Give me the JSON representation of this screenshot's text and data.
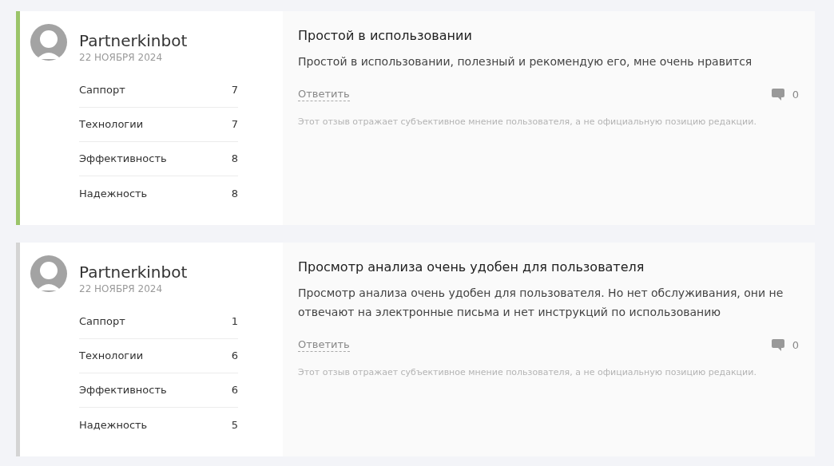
{
  "reviews": [
    {
      "color": "#9bc46a",
      "author": "Partnerkinbot",
      "date": "22 НОЯБРЯ 2024",
      "ratings": [
        {
          "label": "Саппорт",
          "value": "7"
        },
        {
          "label": "Технологии",
          "value": "7"
        },
        {
          "label": "Эффективность",
          "value": "8"
        },
        {
          "label": "Надежность",
          "value": "8"
        }
      ],
      "title": "Простой в использовании",
      "text": "Простой в использовании, полезный и рекомендую его, мне очень нравится",
      "reply": "Ответить",
      "comments": "0",
      "disclaimer": "Этот отзыв отражает субъективное мнение пользователя, а не официальную позицию редакции."
    },
    {
      "color": "#d4d4d4",
      "author": "Partnerkinbot",
      "date": "22 НОЯБРЯ 2024",
      "ratings": [
        {
          "label": "Саппорт",
          "value": "1"
        },
        {
          "label": "Технологии",
          "value": "6"
        },
        {
          "label": "Эффективность",
          "value": "6"
        },
        {
          "label": "Надежность",
          "value": "5"
        }
      ],
      "title": "Просмотр анализа очень удобен для пользователя",
      "text": "Просмотр анализа очень удобен для пользователя. Но нет обслуживания, они не отвечают на электронные письма и нет инструкций по использованию",
      "reply": "Ответить",
      "comments": "0",
      "disclaimer": "Этот отзыв отражает субъективное мнение пользователя, а не официальную позицию редакции."
    }
  ]
}
